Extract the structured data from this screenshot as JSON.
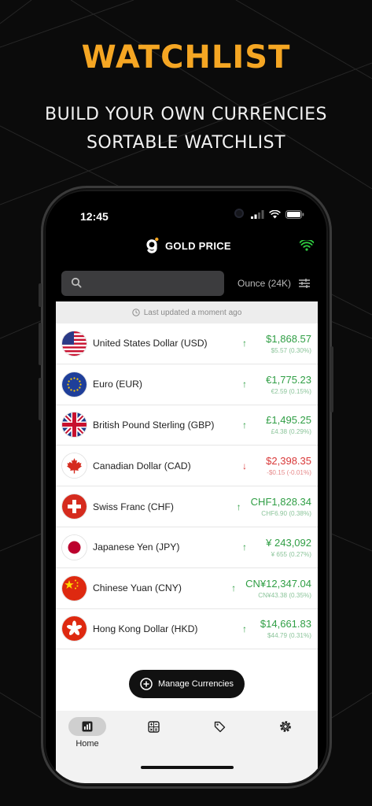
{
  "promo": {
    "title": "WATCHLIST",
    "subtitle_line1": "BUILD YOUR OWN CURRENCIES",
    "subtitle_line2": "SORTABLE WATCHLIST"
  },
  "status_bar": {
    "time": "12:45"
  },
  "app": {
    "name": "GOLD PRICE",
    "brand_color": "#f5a623",
    "connection_icon": "wifi-icon",
    "connection_color": "#2ecc40"
  },
  "search": {
    "placeholder": "",
    "value": ""
  },
  "unit_selector": {
    "label": "Ounce (24K)",
    "icon": "sliders-icon"
  },
  "updated": {
    "text": "Last updated a moment ago"
  },
  "currencies": [
    {
      "name": "United States Dollar (USD)",
      "price": "$1,868.57",
      "change": "$5.57 (0.30%)",
      "direction": "up",
      "flag": "us-flag"
    },
    {
      "name": "Euro (EUR)",
      "price": "€1,775.23",
      "change": "€2.59 (0.15%)",
      "direction": "up",
      "flag": "eu-flag"
    },
    {
      "name": "British Pound Sterling (GBP)",
      "price": "£1,495.25",
      "change": "£4.38 (0.29%)",
      "direction": "up",
      "flag": "gb-flag"
    },
    {
      "name": "Canadian Dollar (CAD)",
      "price": "$2,398.35",
      "change": "-$0.15 (-0.01%)",
      "direction": "down",
      "flag": "ca-flag"
    },
    {
      "name": "Swiss Franc (CHF)",
      "price": "CHF1,828.34",
      "change": "CHF6.90 (0.38%)",
      "direction": "up",
      "flag": "ch-flag"
    },
    {
      "name": "Japanese Yen (JPY)",
      "price": "¥ 243,092",
      "change": "¥ 655 (0.27%)",
      "direction": "up",
      "flag": "jp-flag"
    },
    {
      "name": "Chinese Yuan (CNY)",
      "price": "CN¥12,347.04",
      "change": "CN¥43.38 (0.35%)",
      "direction": "up",
      "flag": "cn-flag"
    },
    {
      "name": "Hong Kong Dollar (HKD)",
      "price": "$14,661.83",
      "change": "$44.79 (0.31%)",
      "direction": "up",
      "flag": "hk-flag"
    }
  ],
  "manage_button": {
    "label": "Manage Currencies",
    "icon": "plus-circle-icon"
  },
  "tabs": [
    {
      "label": "Home",
      "icon": "chart-icon",
      "active": true
    },
    {
      "label": "",
      "icon": "calculator-icon",
      "active": false
    },
    {
      "label": "",
      "icon": "tag-icon",
      "active": false
    },
    {
      "label": "",
      "icon": "gear-icon",
      "active": false
    }
  ],
  "colors": {
    "up": "#2f9e44",
    "down": "#d93838",
    "accent": "#f5a623"
  }
}
